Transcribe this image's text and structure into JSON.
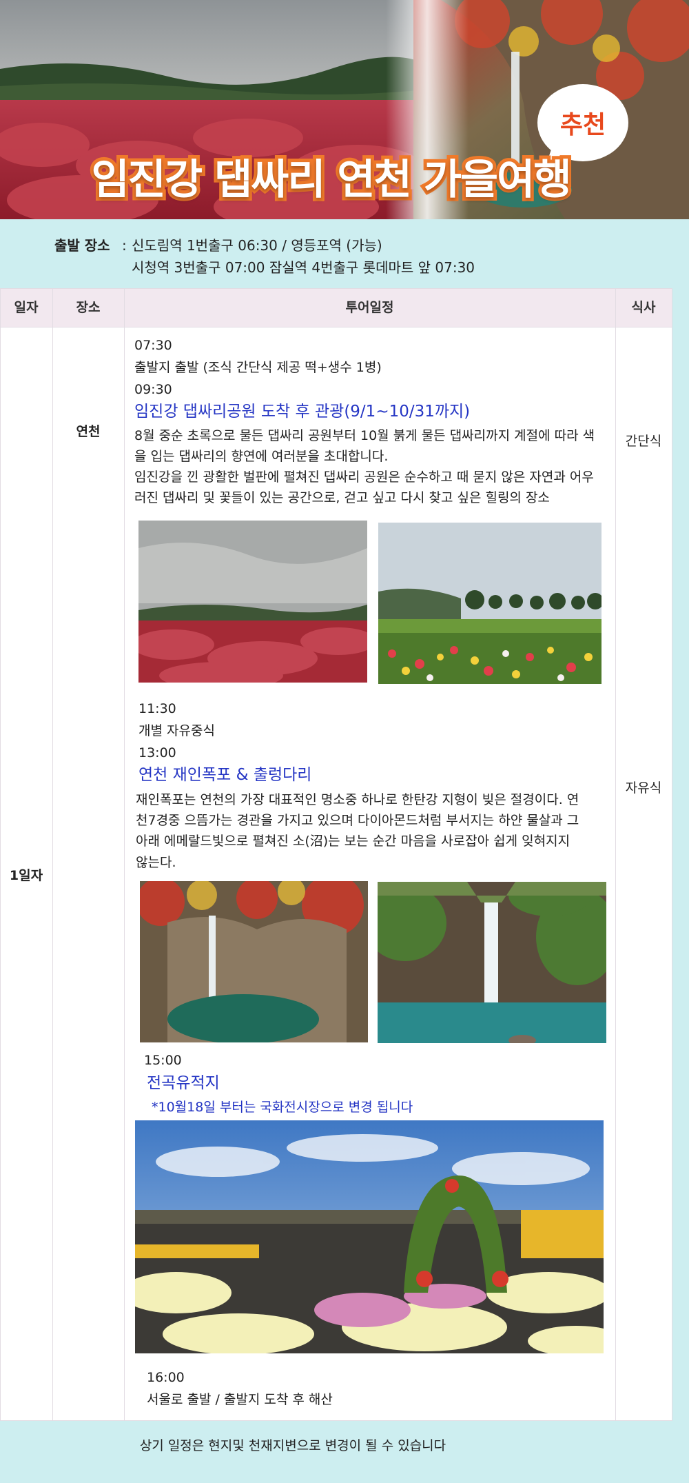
{
  "banner": {
    "title": "임진강 댑싸리 연천 가을여행",
    "badge": "추천"
  },
  "departure": {
    "label": "출발 장소",
    "colon": ":",
    "line1": "신도림역 1번출구 06:30 / 영등포역 (가능)",
    "line2": "시청역 3번출구 07:00   잠실역 4번출구 롯데마트 앞  07:30"
  },
  "table": {
    "headers": {
      "day": "일자",
      "place": "장소",
      "schedule": "투어일정",
      "meal": "식사"
    },
    "day": "1일자",
    "place": "연천",
    "meals": [
      "간단식",
      "자유식"
    ]
  },
  "itinerary": {
    "t1": "07:30",
    "t1_desc": "출발지 출발 (조식 간단식 제공 떡+생수 1병)",
    "t2": "09:30",
    "spot1_title": "임진강 댑싸리공원 도착 후 관광(9/1~10/31까지)",
    "spot1_desc": [
      "8월 중순 초록으로 물든 댑싸리 공원부터 10월 붉게 물든 댑싸리까지 계절에 따라 색",
      "을 입는 댑싸리의 향연에 여러분을 초대합니다.",
      "임진강을 낀 광활한 벌판에 펼쳐진 댑싸리 공원은 순수하고 때 묻지 않은 자연과 어우",
      "러진 댑싸리 및 꽃들이 있는 공간으로, 걷고 싶고 다시 찾고 싶은 힐링의 장소"
    ],
    "t3": "11:30",
    "t3_desc": "개별 자유중식",
    "t4": "13:00",
    "spot2_title": "연천 재인폭포 & 출렁다리",
    "spot2_desc": [
      "재인폭포는 연천의 가장 대표적인 명소중 하나로 한탄강 지형이 빚은 절경이다. 연",
      "천7경중 으뜸가는 경관을 가지고 있으며 다이아몬드처럼 부서지는 하얀 물살과 그",
      "아래 에메랄드빛으로 펼쳐진 소(沼)는 보는 순간 마음을 사로잡아 쉽게 잊혀지지",
      "않는다."
    ],
    "t5": "15:00",
    "spot3_title": "전곡유적지",
    "spot3_note": "*10월18일 부터는 국화전시장으로 변경 됩니다",
    "t6": "16:00",
    "t6_desc": "서울로 출발 / 출발지 도착 후 해산"
  },
  "footer": {
    "note": "상기 일정은 현지및 천재지변으로 변경이 될 수 있습니다"
  },
  "colors": {
    "background": "#cdeef0",
    "header_bg": "#f2e8ef",
    "title_orange": "#f07a2a",
    "badge_red": "#e8491d",
    "highlight_blue": "#2435c4"
  }
}
